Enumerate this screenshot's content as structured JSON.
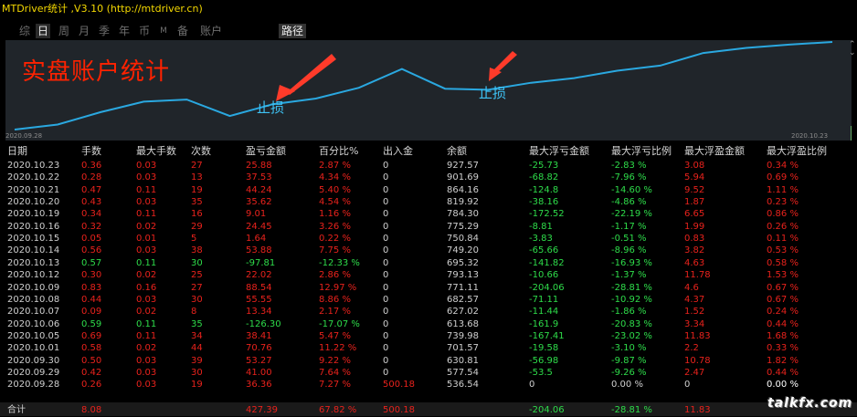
{
  "window": {
    "title": "MTDriver统计 ,V3.10 (http://mtdriver.cn)"
  },
  "tabs": [
    {
      "label": "综",
      "active": false
    },
    {
      "label": "日",
      "active": true
    },
    {
      "label": "周",
      "active": false
    },
    {
      "label": "月",
      "active": false
    },
    {
      "label": "季",
      "active": false
    },
    {
      "label": "年",
      "active": false
    },
    {
      "label": "币",
      "active": false
    },
    {
      "label": "M",
      "active": false
    },
    {
      "label": "备",
      "active": false
    },
    {
      "label": "账户",
      "active": false
    }
  ],
  "path_button": "路径",
  "chart": {
    "heading": "实盘账户统计",
    "start_date": "2020.09.28",
    "end_date": "2020.10.23",
    "annotation_1": "止损",
    "annotation_2": "止损",
    "line_color": "#2aa8e0",
    "heading_color": "#ff2200",
    "arrow_color": "#ff3b2a"
  },
  "chart_data": {
    "type": "line",
    "x": [
      "2020.09.28",
      "2020.09.29",
      "2020.09.30",
      "2020.10.01",
      "2020.10.02",
      "2020.10.05",
      "2020.10.06",
      "2020.10.07",
      "2020.10.08",
      "2020.10.09",
      "2020.10.12",
      "2020.10.13",
      "2020.10.14",
      "2020.10.15",
      "2020.10.16",
      "2020.10.19",
      "2020.10.20",
      "2020.10.21",
      "2020.10.22",
      "2020.10.23"
    ],
    "y": [
      0,
      5.06,
      17.47,
      27.99,
      30.16,
      13.62,
      25.44,
      31.18,
      41.96,
      60.83,
      41.02,
      39.94,
      47.03,
      51.68,
      59.11,
      64.25,
      76.87,
      81.99,
      85.31,
      87.93
    ],
    "xlabel": "",
    "ylabel": ""
  },
  "table": {
    "columns": [
      "日期",
      "手数",
      "最大手数",
      "次数",
      "盈亏金额",
      "百分比%",
      "出入金",
      "余额",
      "最大浮亏金额",
      "最大浮亏比例",
      "最大浮盈金额",
      "最大浮盈比例"
    ],
    "rows": [
      {
        "date": "2020.10.23",
        "lots": "0.36",
        "max_lots": "0.03",
        "count": "27",
        "pnl": "25.88",
        "pct": "2.87 %",
        "deposit": "0",
        "balance": "927.57",
        "max_dd": "-25.73",
        "max_dd_pct": "-2.83 %",
        "max_fp": "3.08",
        "max_fp_pct": "0.34 %",
        "type": "gain"
      },
      {
        "date": "2020.10.22",
        "lots": "0.28",
        "max_lots": "0.03",
        "count": "13",
        "pnl": "37.53",
        "pct": "4.34 %",
        "deposit": "0",
        "balance": "901.69",
        "max_dd": "-68.82",
        "max_dd_pct": "-7.96 %",
        "max_fp": "5.94",
        "max_fp_pct": "0.69 %",
        "type": "gain"
      },
      {
        "date": "2020.10.21",
        "lots": "0.47",
        "max_lots": "0.11",
        "count": "19",
        "pnl": "44.24",
        "pct": "5.40 %",
        "deposit": "0",
        "balance": "864.16",
        "max_dd": "-124.8",
        "max_dd_pct": "-14.60 %",
        "max_fp": "9.52",
        "max_fp_pct": "1.11 %",
        "type": "gain"
      },
      {
        "date": "2020.10.20",
        "lots": "0.43",
        "max_lots": "0.03",
        "count": "35",
        "pnl": "35.62",
        "pct": "4.54 %",
        "deposit": "0",
        "balance": "819.92",
        "max_dd": "-38.16",
        "max_dd_pct": "-4.86 %",
        "max_fp": "1.87",
        "max_fp_pct": "0.23 %",
        "type": "gain"
      },
      {
        "date": "2020.10.19",
        "lots": "0.34",
        "max_lots": "0.11",
        "count": "16",
        "pnl": "9.01",
        "pct": "1.16 %",
        "deposit": "0",
        "balance": "784.30",
        "max_dd": "-172.52",
        "max_dd_pct": "-22.19 %",
        "max_fp": "6.65",
        "max_fp_pct": "0.86 %",
        "type": "gain"
      },
      {
        "date": "2020.10.16",
        "lots": "0.32",
        "max_lots": "0.02",
        "count": "29",
        "pnl": "24.45",
        "pct": "3.26 %",
        "deposit": "0",
        "balance": "775.29",
        "max_dd": "-8.81",
        "max_dd_pct": "-1.17 %",
        "max_fp": "1.99",
        "max_fp_pct": "0.26 %",
        "type": "gain"
      },
      {
        "date": "2020.10.15",
        "lots": "0.05",
        "max_lots": "0.01",
        "count": "5",
        "pnl": "1.64",
        "pct": "0.22 %",
        "deposit": "0",
        "balance": "750.84",
        "max_dd": "-3.83",
        "max_dd_pct": "-0.51 %",
        "max_fp": "0.83",
        "max_fp_pct": "0.11 %",
        "type": "gain"
      },
      {
        "date": "2020.10.14",
        "lots": "0.56",
        "max_lots": "0.03",
        "count": "38",
        "pnl": "53.88",
        "pct": "7.75 %",
        "deposit": "0",
        "balance": "749.20",
        "max_dd": "-65.66",
        "max_dd_pct": "-8.96 %",
        "max_fp": "3.82",
        "max_fp_pct": "0.53 %",
        "type": "gain"
      },
      {
        "date": "2020.10.13",
        "lots": "0.57",
        "max_lots": "0.11",
        "count": "30",
        "pnl": "-97.81",
        "pct": "-12.33 %",
        "deposit": "0",
        "balance": "695.32",
        "max_dd": "-141.82",
        "max_dd_pct": "-16.93 %",
        "max_fp": "4.63",
        "max_fp_pct": "0.58 %",
        "type": "loss"
      },
      {
        "date": "2020.10.12",
        "lots": "0.30",
        "max_lots": "0.02",
        "count": "25",
        "pnl": "22.02",
        "pct": "2.86 %",
        "deposit": "0",
        "balance": "793.13",
        "max_dd": "-10.66",
        "max_dd_pct": "-1.37 %",
        "max_fp": "11.78",
        "max_fp_pct": "1.53 %",
        "type": "gain"
      },
      {
        "date": "2020.10.09",
        "lots": "0.83",
        "max_lots": "0.16",
        "count": "27",
        "pnl": "88.54",
        "pct": "12.97 %",
        "deposit": "0",
        "balance": "771.11",
        "max_dd": "-204.06",
        "max_dd_pct": "-28.81 %",
        "max_fp": "4.6",
        "max_fp_pct": "0.67 %",
        "type": "gain"
      },
      {
        "date": "2020.10.08",
        "lots": "0.44",
        "max_lots": "0.03",
        "count": "30",
        "pnl": "55.55",
        "pct": "8.86 %",
        "deposit": "0",
        "balance": "682.57",
        "max_dd": "-71.11",
        "max_dd_pct": "-10.92 %",
        "max_fp": "4.37",
        "max_fp_pct": "0.67 %",
        "type": "gain"
      },
      {
        "date": "2020.10.07",
        "lots": "0.09",
        "max_lots": "0.02",
        "count": "8",
        "pnl": "13.34",
        "pct": "2.17 %",
        "deposit": "0",
        "balance": "627.02",
        "max_dd": "-11.44",
        "max_dd_pct": "-1.86 %",
        "max_fp": "1.52",
        "max_fp_pct": "0.24 %",
        "type": "gain"
      },
      {
        "date": "2020.10.06",
        "lots": "0.59",
        "max_lots": "0.11",
        "count": "35",
        "pnl": "-126.30",
        "pct": "-17.07 %",
        "deposit": "0",
        "balance": "613.68",
        "max_dd": "-161.9",
        "max_dd_pct": "-20.83 %",
        "max_fp": "3.34",
        "max_fp_pct": "0.44 %",
        "type": "loss"
      },
      {
        "date": "2020.10.05",
        "lots": "0.69",
        "max_lots": "0.11",
        "count": "34",
        "pnl": "38.41",
        "pct": "5.47 %",
        "deposit": "0",
        "balance": "739.98",
        "max_dd": "-167.41",
        "max_dd_pct": "-23.02 %",
        "max_fp": "11.83",
        "max_fp_pct": "1.68 %",
        "type": "gain"
      },
      {
        "date": "2020.10.01",
        "lots": "0.58",
        "max_lots": "0.02",
        "count": "44",
        "pnl": "70.76",
        "pct": "11.22 %",
        "deposit": "0",
        "balance": "701.57",
        "max_dd": "-19.58",
        "max_dd_pct": "-3.10 %",
        "max_fp": "2.2",
        "max_fp_pct": "0.33 %",
        "type": "gain"
      },
      {
        "date": "2020.09.30",
        "lots": "0.50",
        "max_lots": "0.03",
        "count": "39",
        "pnl": "53.27",
        "pct": "9.22 %",
        "deposit": "0",
        "balance": "630.81",
        "max_dd": "-56.98",
        "max_dd_pct": "-9.87 %",
        "max_fp": "10.78",
        "max_fp_pct": "1.82 %",
        "type": "gain"
      },
      {
        "date": "2020.09.29",
        "lots": "0.42",
        "max_lots": "0.03",
        "count": "30",
        "pnl": "41.00",
        "pct": "7.64 %",
        "deposit": "0",
        "balance": "577.54",
        "max_dd": "-53.5",
        "max_dd_pct": "-9.26 %",
        "max_fp": "2.47",
        "max_fp_pct": "0.44 %",
        "type": "gain"
      },
      {
        "date": "2020.09.28",
        "lots": "0.26",
        "max_lots": "0.03",
        "count": "19",
        "pnl": "36.36",
        "pct": "7.27 %",
        "deposit": "500.18",
        "balance": "536.54",
        "max_dd": "0",
        "max_dd_pct": "0.00 %",
        "max_fp": "0",
        "max_fp_pct": "0.00 %",
        "type": "first"
      }
    ],
    "total": {
      "label": "合计",
      "lots": "8.08",
      "pnl": "427.39",
      "pct": "67.82 %",
      "deposit": "500.18",
      "max_dd": "-204.06",
      "max_dd_pct": "-28.81 %",
      "max_fp": "11.83"
    }
  },
  "colors": {
    "gain": "#e8221c",
    "loss": "#2edc4a",
    "neutral": "#cfcfcf",
    "title": "#f4d800"
  },
  "watermark": "talkfx.com"
}
